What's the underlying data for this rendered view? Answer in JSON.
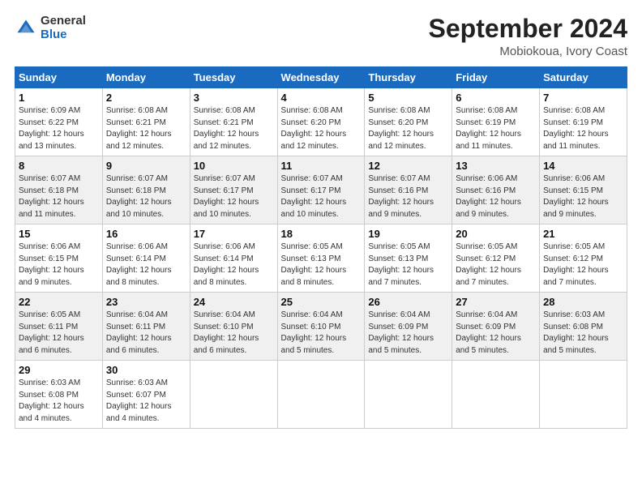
{
  "logo": {
    "general": "General",
    "blue": "Blue"
  },
  "title": "September 2024",
  "location": "Mobiokoua, Ivory Coast",
  "headers": [
    "Sunday",
    "Monday",
    "Tuesday",
    "Wednesday",
    "Thursday",
    "Friday",
    "Saturday"
  ],
  "weeks": [
    [
      {
        "day": "1",
        "info": "Sunrise: 6:09 AM\nSunset: 6:22 PM\nDaylight: 12 hours\nand 13 minutes."
      },
      {
        "day": "2",
        "info": "Sunrise: 6:08 AM\nSunset: 6:21 PM\nDaylight: 12 hours\nand 12 minutes."
      },
      {
        "day": "3",
        "info": "Sunrise: 6:08 AM\nSunset: 6:21 PM\nDaylight: 12 hours\nand 12 minutes."
      },
      {
        "day": "4",
        "info": "Sunrise: 6:08 AM\nSunset: 6:20 PM\nDaylight: 12 hours\nand 12 minutes."
      },
      {
        "day": "5",
        "info": "Sunrise: 6:08 AM\nSunset: 6:20 PM\nDaylight: 12 hours\nand 12 minutes."
      },
      {
        "day": "6",
        "info": "Sunrise: 6:08 AM\nSunset: 6:19 PM\nDaylight: 12 hours\nand 11 minutes."
      },
      {
        "day": "7",
        "info": "Sunrise: 6:08 AM\nSunset: 6:19 PM\nDaylight: 12 hours\nand 11 minutes."
      }
    ],
    [
      {
        "day": "8",
        "info": "Sunrise: 6:07 AM\nSunset: 6:18 PM\nDaylight: 12 hours\nand 11 minutes."
      },
      {
        "day": "9",
        "info": "Sunrise: 6:07 AM\nSunset: 6:18 PM\nDaylight: 12 hours\nand 10 minutes."
      },
      {
        "day": "10",
        "info": "Sunrise: 6:07 AM\nSunset: 6:17 PM\nDaylight: 12 hours\nand 10 minutes."
      },
      {
        "day": "11",
        "info": "Sunrise: 6:07 AM\nSunset: 6:17 PM\nDaylight: 12 hours\nand 10 minutes."
      },
      {
        "day": "12",
        "info": "Sunrise: 6:07 AM\nSunset: 6:16 PM\nDaylight: 12 hours\nand 9 minutes."
      },
      {
        "day": "13",
        "info": "Sunrise: 6:06 AM\nSunset: 6:16 PM\nDaylight: 12 hours\nand 9 minutes."
      },
      {
        "day": "14",
        "info": "Sunrise: 6:06 AM\nSunset: 6:15 PM\nDaylight: 12 hours\nand 9 minutes."
      }
    ],
    [
      {
        "day": "15",
        "info": "Sunrise: 6:06 AM\nSunset: 6:15 PM\nDaylight: 12 hours\nand 9 minutes."
      },
      {
        "day": "16",
        "info": "Sunrise: 6:06 AM\nSunset: 6:14 PM\nDaylight: 12 hours\nand 8 minutes."
      },
      {
        "day": "17",
        "info": "Sunrise: 6:06 AM\nSunset: 6:14 PM\nDaylight: 12 hours\nand 8 minutes."
      },
      {
        "day": "18",
        "info": "Sunrise: 6:05 AM\nSunset: 6:13 PM\nDaylight: 12 hours\nand 8 minutes."
      },
      {
        "day": "19",
        "info": "Sunrise: 6:05 AM\nSunset: 6:13 PM\nDaylight: 12 hours\nand 7 minutes."
      },
      {
        "day": "20",
        "info": "Sunrise: 6:05 AM\nSunset: 6:12 PM\nDaylight: 12 hours\nand 7 minutes."
      },
      {
        "day": "21",
        "info": "Sunrise: 6:05 AM\nSunset: 6:12 PM\nDaylight: 12 hours\nand 7 minutes."
      }
    ],
    [
      {
        "day": "22",
        "info": "Sunrise: 6:05 AM\nSunset: 6:11 PM\nDaylight: 12 hours\nand 6 minutes."
      },
      {
        "day": "23",
        "info": "Sunrise: 6:04 AM\nSunset: 6:11 PM\nDaylight: 12 hours\nand 6 minutes."
      },
      {
        "day": "24",
        "info": "Sunrise: 6:04 AM\nSunset: 6:10 PM\nDaylight: 12 hours\nand 6 minutes."
      },
      {
        "day": "25",
        "info": "Sunrise: 6:04 AM\nSunset: 6:10 PM\nDaylight: 12 hours\nand 5 minutes."
      },
      {
        "day": "26",
        "info": "Sunrise: 6:04 AM\nSunset: 6:09 PM\nDaylight: 12 hours\nand 5 minutes."
      },
      {
        "day": "27",
        "info": "Sunrise: 6:04 AM\nSunset: 6:09 PM\nDaylight: 12 hours\nand 5 minutes."
      },
      {
        "day": "28",
        "info": "Sunrise: 6:03 AM\nSunset: 6:08 PM\nDaylight: 12 hours\nand 5 minutes."
      }
    ],
    [
      {
        "day": "29",
        "info": "Sunrise: 6:03 AM\nSunset: 6:08 PM\nDaylight: 12 hours\nand 4 minutes."
      },
      {
        "day": "30",
        "info": "Sunrise: 6:03 AM\nSunset: 6:07 PM\nDaylight: 12 hours\nand 4 minutes."
      },
      {
        "day": "",
        "info": ""
      },
      {
        "day": "",
        "info": ""
      },
      {
        "day": "",
        "info": ""
      },
      {
        "day": "",
        "info": ""
      },
      {
        "day": "",
        "info": ""
      }
    ]
  ]
}
